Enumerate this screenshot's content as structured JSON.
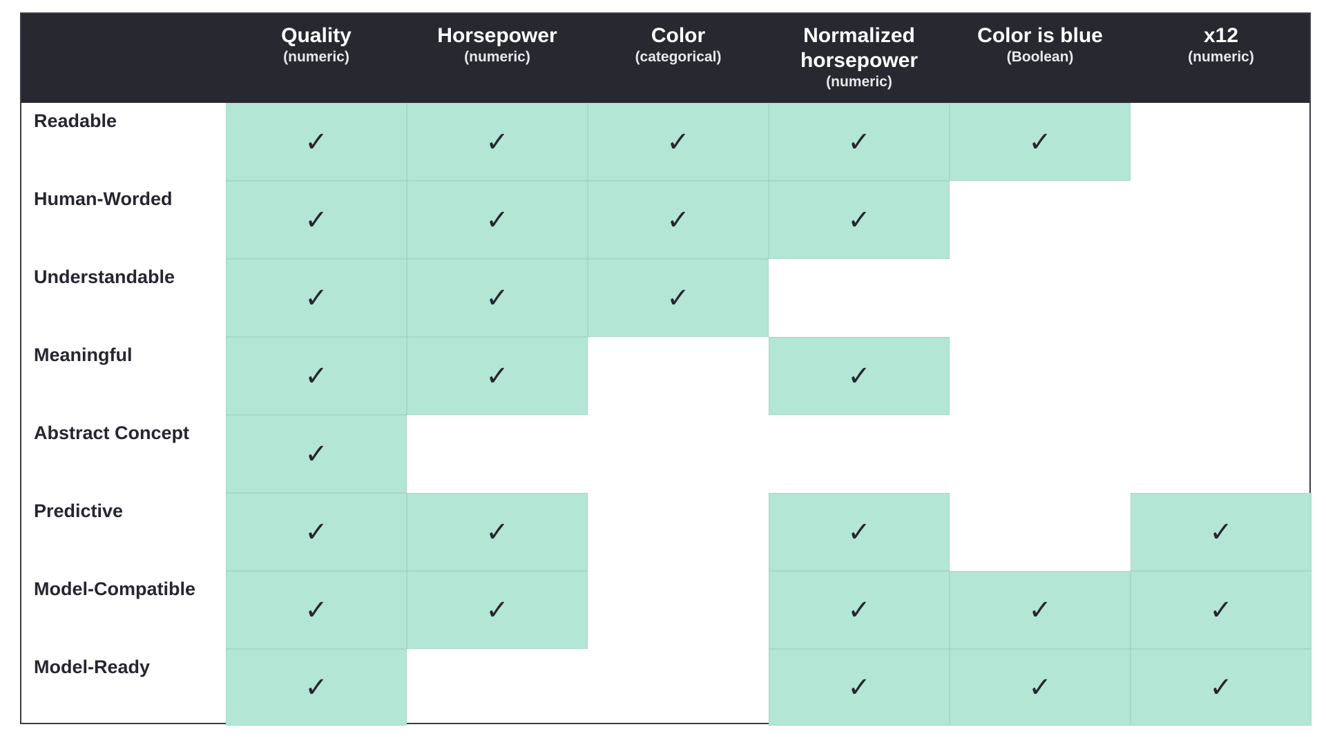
{
  "columns": [
    {
      "title": "Quality",
      "type": "(numeric)"
    },
    {
      "title": "Horsepower",
      "type": "(numeric)"
    },
    {
      "title": "Color",
      "type": "(categorical)"
    },
    {
      "title": "Normalized horsepower",
      "type": "(numeric)"
    },
    {
      "title": "Color is blue",
      "type": "(Boolean)"
    },
    {
      "title": "x12",
      "type": "(numeric)"
    }
  ],
  "rows": [
    {
      "label": "Readable",
      "values": [
        true,
        true,
        true,
        true,
        true,
        false
      ]
    },
    {
      "label": "Human-Worded",
      "values": [
        true,
        true,
        true,
        true,
        false,
        false
      ]
    },
    {
      "label": "Understandable",
      "values": [
        true,
        true,
        true,
        false,
        false,
        false
      ]
    },
    {
      "label": "Meaningful",
      "values": [
        true,
        true,
        false,
        true,
        false,
        false
      ]
    },
    {
      "label": "Abstract Concept",
      "values": [
        true,
        false,
        false,
        false,
        false,
        false
      ]
    },
    {
      "label": "Predictive",
      "values": [
        true,
        true,
        false,
        true,
        false,
        true
      ]
    },
    {
      "label": "Model-Compatible",
      "values": [
        true,
        true,
        false,
        true,
        true,
        true
      ]
    },
    {
      "label": "Model-Ready",
      "values": [
        true,
        false,
        false,
        true,
        true,
        true
      ]
    }
  ],
  "check_glyph": "✓",
  "icons": {
    "check": "check-icon"
  },
  "colors": {
    "header_bg": "#282830",
    "fill": "#b3e6d4",
    "text": "#262630"
  }
}
